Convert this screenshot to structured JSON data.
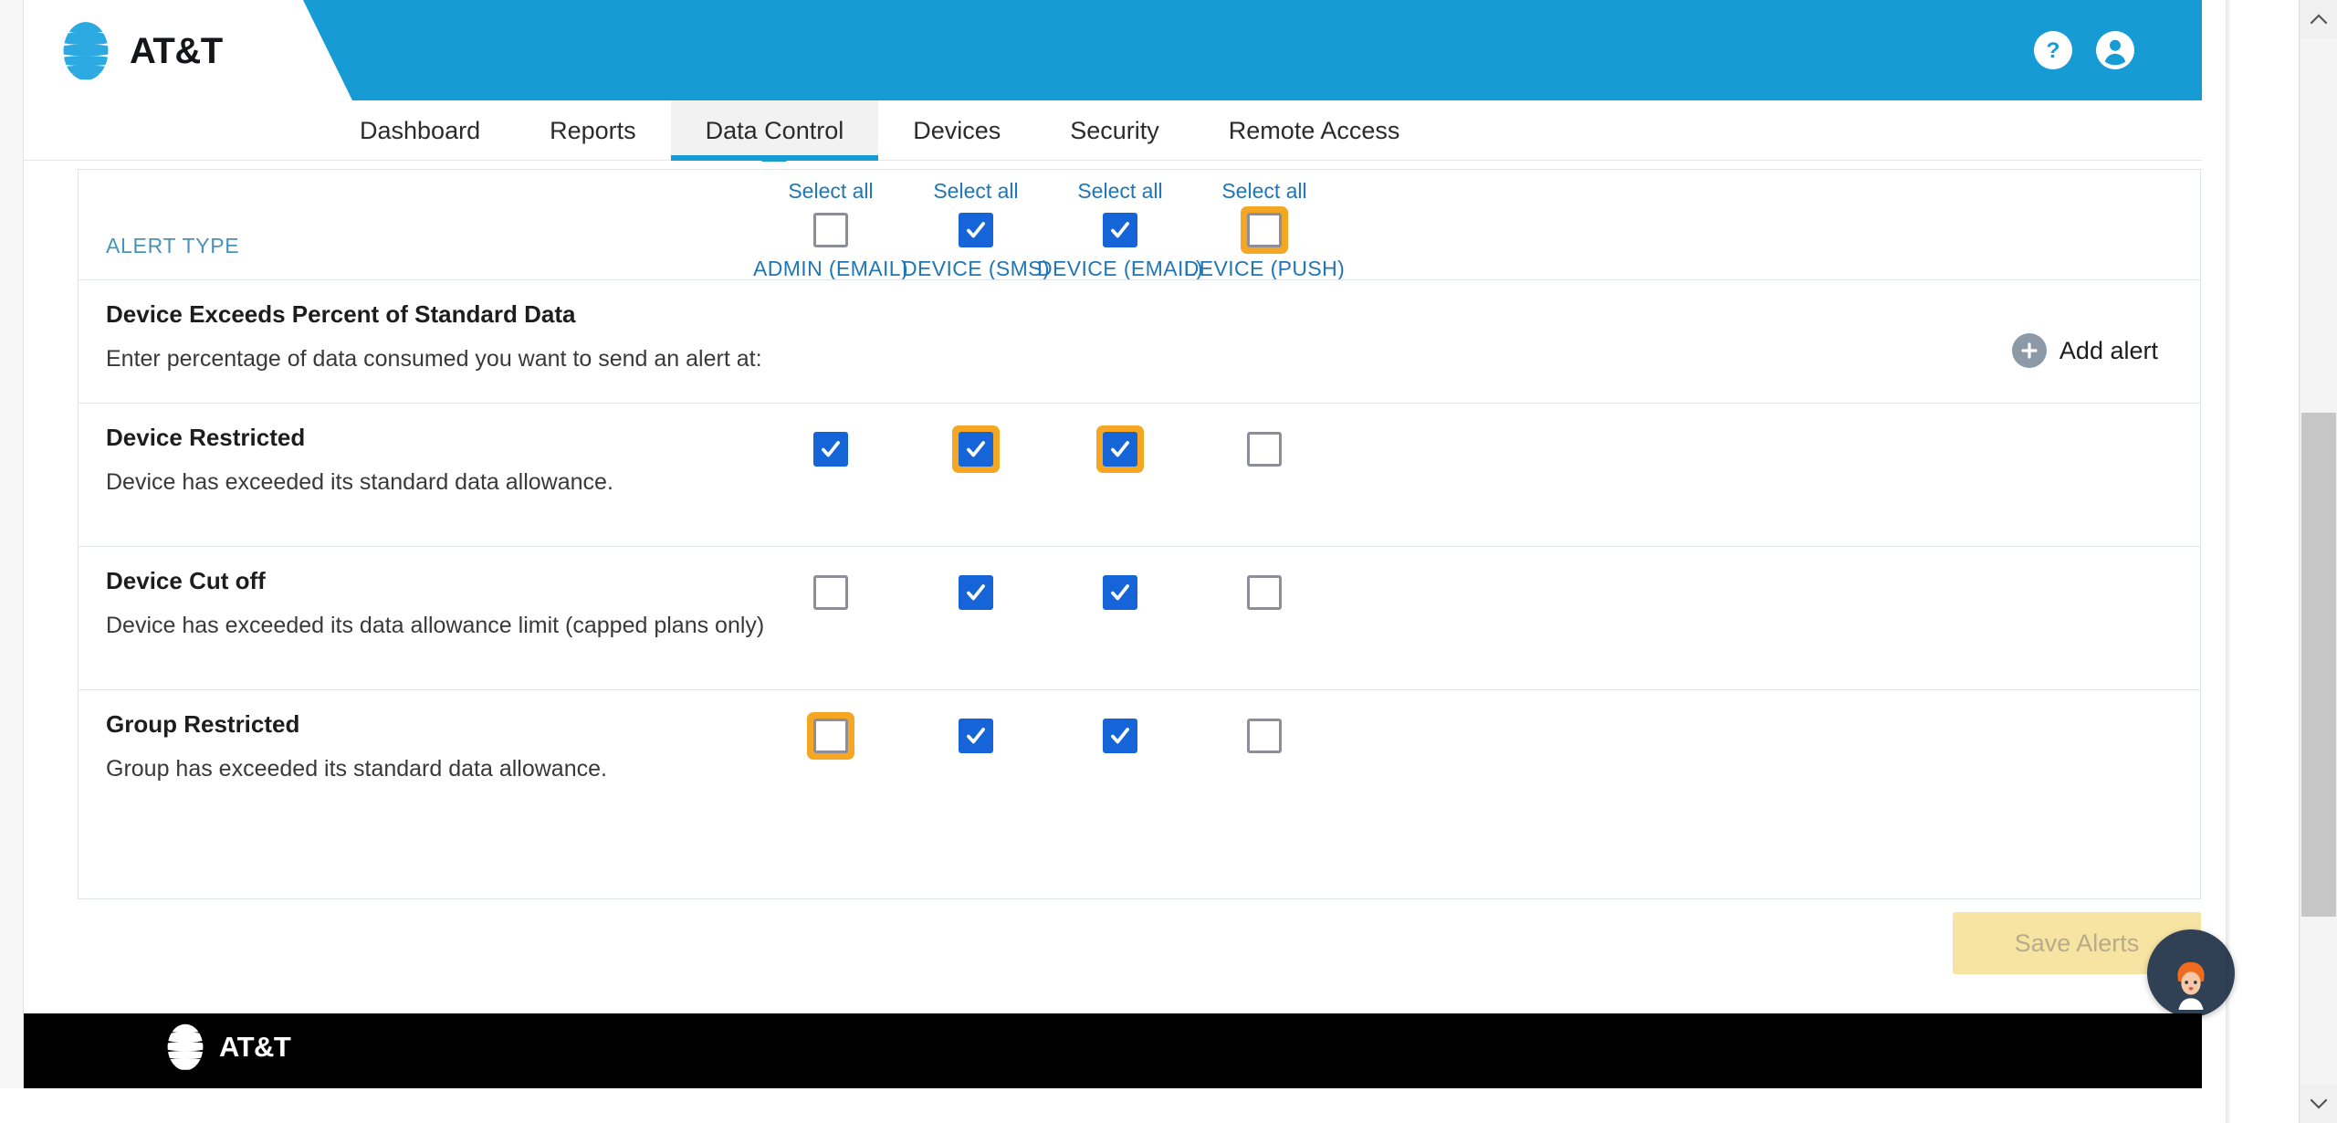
{
  "brand": {
    "name": "AT&T",
    "logo_icon": "att-globe-icon"
  },
  "header": {
    "help_icon": "help-circle-icon",
    "account_icon": "user-account-icon",
    "background_color": "#169bd5"
  },
  "nav": {
    "items": [
      {
        "label": "Dashboard",
        "active": false
      },
      {
        "label": "Reports",
        "active": false
      },
      {
        "label": "Data Control",
        "active": true
      },
      {
        "label": "Devices",
        "active": false
      },
      {
        "label": "Security",
        "active": false
      },
      {
        "label": "Remote Access",
        "active": false
      }
    ]
  },
  "table": {
    "alert_type_label": "ALERT TYPE",
    "select_all_label": "Select all",
    "columns": [
      {
        "name": "ADMIN (EMAIL)",
        "select_all_checked": false,
        "select_all_highlighted": false
      },
      {
        "name": "DEVICE (SMS)",
        "select_all_checked": true,
        "select_all_highlighted": false
      },
      {
        "name": "DEVICE (EMAIL)",
        "select_all_checked": true,
        "select_all_highlighted": false
      },
      {
        "name": "DEVICE (PUSH)",
        "select_all_checked": false,
        "select_all_highlighted": true
      }
    ],
    "rows": [
      {
        "title": "Device Exceeds Percent of Standard Data",
        "description": "Enter percentage of data consumed you want to send an alert at:",
        "has_add_alert": true,
        "add_alert_label": "Add alert",
        "add_alert_icon": "plus-circle-icon",
        "checkboxes": []
      },
      {
        "title": "Device Restricted",
        "description": "Device has exceeded its standard data allowance.",
        "has_add_alert": false,
        "checkboxes": [
          {
            "checked": true,
            "highlighted": false
          },
          {
            "checked": true,
            "highlighted": true
          },
          {
            "checked": true,
            "highlighted": true
          },
          {
            "checked": false,
            "highlighted": false
          }
        ]
      },
      {
        "title": "Device Cut off",
        "description": "Device has exceeded its data allowance limit (capped plans only)",
        "has_add_alert": false,
        "checkboxes": [
          {
            "checked": false,
            "highlighted": false
          },
          {
            "checked": true,
            "highlighted": false
          },
          {
            "checked": true,
            "highlighted": false
          },
          {
            "checked": false,
            "highlighted": false
          }
        ]
      },
      {
        "title": "Group Restricted",
        "description": "Group has exceeded its standard data allowance.",
        "has_add_alert": false,
        "checkboxes": [
          {
            "checked": false,
            "highlighted": true
          },
          {
            "checked": true,
            "highlighted": false
          },
          {
            "checked": true,
            "highlighted": false
          },
          {
            "checked": false,
            "highlighted": false
          }
        ]
      }
    ]
  },
  "actions": {
    "save_label": "Save Alerts",
    "save_disabled": true
  },
  "chat": {
    "icon": "support-agent-avatar-icon"
  },
  "footer": {
    "brand": "AT&T",
    "logo_icon": "att-globe-icon",
    "background_color": "#000000"
  },
  "scrollbar": {
    "up_icon": "chevron-up-icon",
    "down_icon": "chevron-down-icon"
  },
  "colors": {
    "accent_blue": "#169bd5",
    "checkbox_blue": "#1565d8",
    "highlight_orange": "#f5a623",
    "link_blue": "#2176b5",
    "disabled_button": "#f8e4a2"
  }
}
